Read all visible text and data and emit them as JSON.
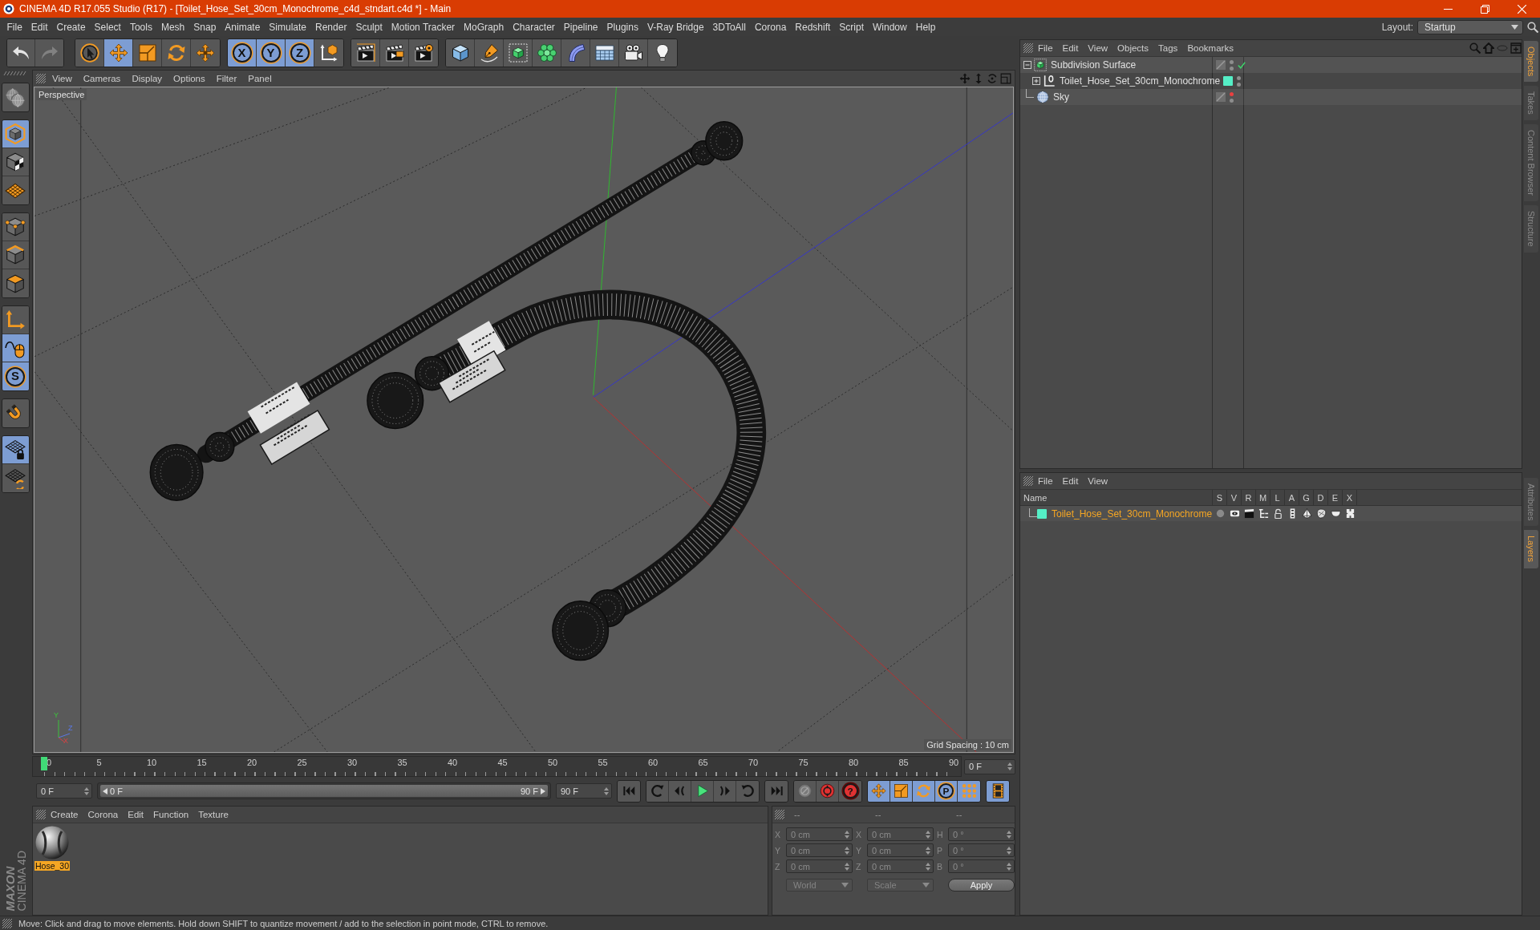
{
  "window": {
    "title": "CINEMA 4D R17.055 Studio (R17) - [Toilet_Hose_Set_30cm_Monochrome_c4d_stndart.c4d *] - Main"
  },
  "menu": [
    "File",
    "Edit",
    "Create",
    "Select",
    "Tools",
    "Mesh",
    "Snap",
    "Animate",
    "Simulate",
    "Render",
    "Sculpt",
    "Motion Tracker",
    "MoGraph",
    "Character",
    "Pipeline",
    "Plugins",
    "V-Ray Bridge",
    "3DToAll",
    "Corona",
    "Redshift",
    "Script",
    "Window",
    "Help"
  ],
  "layout": {
    "label": "Layout:",
    "value": "Startup"
  },
  "toolbar": {
    "history": [
      {
        "kind": "undo",
        "disabled": false
      },
      {
        "kind": "redo",
        "disabled": true
      }
    ],
    "groups": [
      [
        {
          "kind": "select",
          "on": false
        },
        {
          "kind": "move",
          "on": true
        },
        {
          "kind": "scale",
          "on": false
        },
        {
          "kind": "rotate",
          "on": false
        },
        {
          "kind": "recent-tool",
          "on": false
        }
      ],
      [
        {
          "kind": "axis",
          "label": "X",
          "on": true
        },
        {
          "kind": "axis",
          "label": "Y",
          "on": true
        },
        {
          "kind": "axis",
          "label": "Z",
          "on": true
        },
        {
          "kind": "coordinate-system",
          "on": false
        }
      ],
      [
        {
          "kind": "render-view",
          "on": false
        },
        {
          "kind": "render-picture-viewer",
          "on": false
        },
        {
          "kind": "render-settings",
          "on": false
        }
      ],
      [
        {
          "kind": "cube",
          "on": false
        },
        {
          "kind": "pen",
          "on": false
        },
        {
          "kind": "subdivision",
          "on": false
        },
        {
          "kind": "cloner",
          "on": false
        },
        {
          "kind": "bend",
          "on": false
        },
        {
          "kind": "floor",
          "on": false
        },
        {
          "kind": "camera",
          "on": false
        },
        {
          "kind": "light",
          "on": false
        }
      ]
    ]
  },
  "left_toolbar": [
    [
      {
        "kind": "make-editable",
        "on": false
      }
    ],
    [
      {
        "kind": "model",
        "on": true
      },
      {
        "kind": "texture",
        "on": false
      },
      {
        "kind": "workplane",
        "on": false
      }
    ],
    [
      {
        "kind": "points",
        "on": false
      },
      {
        "kind": "edges",
        "on": false
      },
      {
        "kind": "polygons",
        "on": false
      }
    ],
    [
      {
        "kind": "axis-mode",
        "on": false
      },
      {
        "kind": "tweak",
        "on": true
      },
      {
        "kind": "snap",
        "label": "S",
        "on": true
      }
    ],
    [
      {
        "kind": "magnet",
        "on": false
      }
    ],
    [
      {
        "kind": "workplane-lock",
        "on": true
      },
      {
        "kind": "workplane-rotate",
        "on": false
      }
    ]
  ],
  "viewport": {
    "menu": [
      "View",
      "Cameras",
      "Display",
      "Options",
      "Filter",
      "Panel"
    ],
    "camera": "Perspective",
    "grid_spacing": "Grid Spacing : 10 cm",
    "axis_gizmo": [
      "Y",
      "Z",
      "X"
    ]
  },
  "timeline": {
    "ticks": [
      "0",
      "5",
      "10",
      "15",
      "20",
      "25",
      "30",
      "35",
      "40",
      "45",
      "50",
      "55",
      "60",
      "65",
      "70",
      "75",
      "80",
      "85",
      "90"
    ],
    "playhead": {
      "level": 0
    },
    "current_frame": "0 F"
  },
  "transport": {
    "start": "0 F",
    "range": {
      "start": "0 F",
      "end": "90 F",
      "level": 1
    },
    "end": "90 F",
    "groups": [
      [
        {
          "kind": "go-start"
        }
      ],
      [
        {
          "kind": "prev-key"
        },
        {
          "kind": "prev-frame"
        },
        {
          "kind": "play"
        },
        {
          "kind": "next-frame"
        },
        {
          "kind": "next-key"
        }
      ],
      [
        {
          "kind": "go-end"
        }
      ],
      [
        {
          "kind": "record",
          "on": false
        },
        {
          "kind": "autokey",
          "on": false
        },
        {
          "kind": "key-selection",
          "label": "?",
          "on": false
        }
      ],
      [
        {
          "kind": "position",
          "on": true
        },
        {
          "kind": "scale",
          "on": true
        },
        {
          "kind": "rotation",
          "on": true
        },
        {
          "kind": "parameter",
          "label": "P",
          "on": true
        },
        {
          "kind": "point-level",
          "on": true
        }
      ],
      [
        {
          "kind": "timeline",
          "on": true
        }
      ]
    ]
  },
  "materials": {
    "menu": [
      "Create",
      "Corona",
      "Edit",
      "Function",
      "Texture"
    ],
    "items": [
      {
        "name": "Hose_30",
        "selected": true
      }
    ]
  },
  "coordinates": {
    "disabled": true,
    "headers": [
      "--",
      "--",
      "--"
    ],
    "rows": [
      [
        {
          "axis": "X",
          "value": "0 cm"
        },
        {
          "axis": "X",
          "value": "0 cm"
        },
        {
          "axis": "H",
          "value": "0 °"
        }
      ],
      [
        {
          "axis": "Y",
          "value": "0 cm"
        },
        {
          "axis": "Y",
          "value": "0 cm"
        },
        {
          "axis": "P",
          "value": "0 °"
        }
      ],
      [
        {
          "axis": "Z",
          "value": "0 cm"
        },
        {
          "axis": "Z",
          "value": "0 cm"
        },
        {
          "axis": "B",
          "value": "0 °"
        }
      ]
    ],
    "modes": [
      "World",
      "Scale"
    ],
    "apply": "Apply"
  },
  "object_manager": {
    "menu": [
      "File",
      "Edit",
      "View",
      "Objects",
      "Tags",
      "Bookmarks"
    ],
    "objects": [
      {
        "name": "Subdivision Surface",
        "kind": "subdivision",
        "expanded": true,
        "check": true,
        "editor_hidden": false,
        "render_hidden": false,
        "children": [
          {
            "name": "Toilet_Hose_Set_30cm_Monochrome",
            "kind": "null",
            "expanded": false,
            "color": "#55eec6",
            "check": false,
            "editor_hidden": false,
            "render_hidden": false
          }
        ]
      },
      {
        "name": "Sky",
        "kind": "sky",
        "check": false,
        "editor_hidden": true,
        "render_hidden": false
      }
    ]
  },
  "layer_manager": {
    "menu": [
      "File",
      "Edit",
      "View"
    ],
    "columns": [
      "Name",
      "S",
      "V",
      "R",
      "M",
      "L",
      "A",
      "G",
      "D",
      "E",
      "X"
    ],
    "layers": [
      {
        "name": "Toilet_Hose_Set_30cm_Monochrome",
        "color": "#55eec6",
        "selected": true,
        "switches": [
          {
            "on": false
          },
          {
            "on": true
          },
          {
            "on": true
          },
          {
            "on": true
          },
          {
            "on": false
          },
          {
            "on": true
          },
          {
            "on": true
          },
          {
            "on": true
          },
          {
            "on": true
          },
          {
            "on": true
          }
        ]
      }
    ]
  },
  "side_tabs": {
    "upper": [
      {
        "label": "Objects",
        "selected": true
      },
      {
        "label": "Takes",
        "selected": false
      },
      {
        "label": "Content Browser",
        "selected": false
      },
      {
        "label": "Structure",
        "selected": false
      }
    ],
    "lower": [
      {
        "label": "Attributes",
        "selected": false
      },
      {
        "label": "Layers",
        "selected": true
      }
    ]
  },
  "logo": {
    "brand": "MAXON",
    "product": "CINEMA 4D"
  },
  "status_bar": "Move: Click and drag to move elements. Hold down SHIFT to quantize movement / add to the selection in point mode, CTRL to remove."
}
